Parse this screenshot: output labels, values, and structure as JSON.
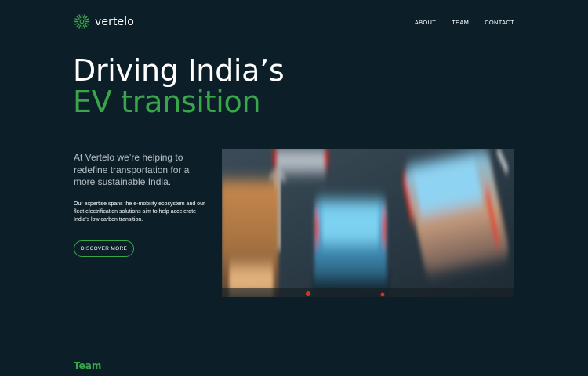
{
  "brand": {
    "name": "vertelo",
    "accent": "#3aa64a",
    "background": "#0c1f29"
  },
  "nav": {
    "items": [
      "ABOUT",
      "TEAM",
      "CONTACT"
    ]
  },
  "hero": {
    "title_line1": "Driving India’s",
    "title_line2": "EV transition",
    "lead": "At Vertelo we’re helping to redefine transportation for a more sustainable India.",
    "body": "Our expertise spans the e-mobility ecosystem and our fleet electrification solutions aim to help accelerate India’s low carbon transition.",
    "cta": "DISCOVER MORE"
  },
  "image": {
    "icon": "blurred-traffic-photo"
  },
  "sections": {
    "team_heading": "Team"
  }
}
